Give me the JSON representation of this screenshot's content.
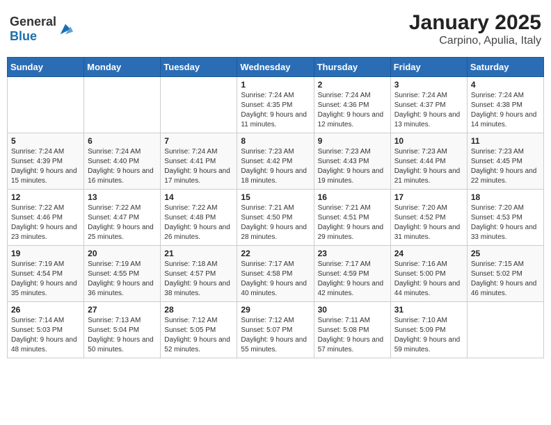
{
  "header": {
    "logo_general": "General",
    "logo_blue": "Blue",
    "title": "January 2025",
    "subtitle": "Carpino, Apulia, Italy"
  },
  "weekdays": [
    "Sunday",
    "Monday",
    "Tuesday",
    "Wednesday",
    "Thursday",
    "Friday",
    "Saturday"
  ],
  "weeks": [
    [
      {
        "day": "",
        "info": ""
      },
      {
        "day": "",
        "info": ""
      },
      {
        "day": "",
        "info": ""
      },
      {
        "day": "1",
        "info": "Sunrise: 7:24 AM\nSunset: 4:35 PM\nDaylight: 9 hours and 11 minutes."
      },
      {
        "day": "2",
        "info": "Sunrise: 7:24 AM\nSunset: 4:36 PM\nDaylight: 9 hours and 12 minutes."
      },
      {
        "day": "3",
        "info": "Sunrise: 7:24 AM\nSunset: 4:37 PM\nDaylight: 9 hours and 13 minutes."
      },
      {
        "day": "4",
        "info": "Sunrise: 7:24 AM\nSunset: 4:38 PM\nDaylight: 9 hours and 14 minutes."
      }
    ],
    [
      {
        "day": "5",
        "info": "Sunrise: 7:24 AM\nSunset: 4:39 PM\nDaylight: 9 hours and 15 minutes."
      },
      {
        "day": "6",
        "info": "Sunrise: 7:24 AM\nSunset: 4:40 PM\nDaylight: 9 hours and 16 minutes."
      },
      {
        "day": "7",
        "info": "Sunrise: 7:24 AM\nSunset: 4:41 PM\nDaylight: 9 hours and 17 minutes."
      },
      {
        "day": "8",
        "info": "Sunrise: 7:23 AM\nSunset: 4:42 PM\nDaylight: 9 hours and 18 minutes."
      },
      {
        "day": "9",
        "info": "Sunrise: 7:23 AM\nSunset: 4:43 PM\nDaylight: 9 hours and 19 minutes."
      },
      {
        "day": "10",
        "info": "Sunrise: 7:23 AM\nSunset: 4:44 PM\nDaylight: 9 hours and 21 minutes."
      },
      {
        "day": "11",
        "info": "Sunrise: 7:23 AM\nSunset: 4:45 PM\nDaylight: 9 hours and 22 minutes."
      }
    ],
    [
      {
        "day": "12",
        "info": "Sunrise: 7:22 AM\nSunset: 4:46 PM\nDaylight: 9 hours and 23 minutes."
      },
      {
        "day": "13",
        "info": "Sunrise: 7:22 AM\nSunset: 4:47 PM\nDaylight: 9 hours and 25 minutes."
      },
      {
        "day": "14",
        "info": "Sunrise: 7:22 AM\nSunset: 4:48 PM\nDaylight: 9 hours and 26 minutes."
      },
      {
        "day": "15",
        "info": "Sunrise: 7:21 AM\nSunset: 4:50 PM\nDaylight: 9 hours and 28 minutes."
      },
      {
        "day": "16",
        "info": "Sunrise: 7:21 AM\nSunset: 4:51 PM\nDaylight: 9 hours and 29 minutes."
      },
      {
        "day": "17",
        "info": "Sunrise: 7:20 AM\nSunset: 4:52 PM\nDaylight: 9 hours and 31 minutes."
      },
      {
        "day": "18",
        "info": "Sunrise: 7:20 AM\nSunset: 4:53 PM\nDaylight: 9 hours and 33 minutes."
      }
    ],
    [
      {
        "day": "19",
        "info": "Sunrise: 7:19 AM\nSunset: 4:54 PM\nDaylight: 9 hours and 35 minutes."
      },
      {
        "day": "20",
        "info": "Sunrise: 7:19 AM\nSunset: 4:55 PM\nDaylight: 9 hours and 36 minutes."
      },
      {
        "day": "21",
        "info": "Sunrise: 7:18 AM\nSunset: 4:57 PM\nDaylight: 9 hours and 38 minutes."
      },
      {
        "day": "22",
        "info": "Sunrise: 7:17 AM\nSunset: 4:58 PM\nDaylight: 9 hours and 40 minutes."
      },
      {
        "day": "23",
        "info": "Sunrise: 7:17 AM\nSunset: 4:59 PM\nDaylight: 9 hours and 42 minutes."
      },
      {
        "day": "24",
        "info": "Sunrise: 7:16 AM\nSunset: 5:00 PM\nDaylight: 9 hours and 44 minutes."
      },
      {
        "day": "25",
        "info": "Sunrise: 7:15 AM\nSunset: 5:02 PM\nDaylight: 9 hours and 46 minutes."
      }
    ],
    [
      {
        "day": "26",
        "info": "Sunrise: 7:14 AM\nSunset: 5:03 PM\nDaylight: 9 hours and 48 minutes."
      },
      {
        "day": "27",
        "info": "Sunrise: 7:13 AM\nSunset: 5:04 PM\nDaylight: 9 hours and 50 minutes."
      },
      {
        "day": "28",
        "info": "Sunrise: 7:12 AM\nSunset: 5:05 PM\nDaylight: 9 hours and 52 minutes."
      },
      {
        "day": "29",
        "info": "Sunrise: 7:12 AM\nSunset: 5:07 PM\nDaylight: 9 hours and 55 minutes."
      },
      {
        "day": "30",
        "info": "Sunrise: 7:11 AM\nSunset: 5:08 PM\nDaylight: 9 hours and 57 minutes."
      },
      {
        "day": "31",
        "info": "Sunrise: 7:10 AM\nSunset: 5:09 PM\nDaylight: 9 hours and 59 minutes."
      },
      {
        "day": "",
        "info": ""
      }
    ]
  ]
}
